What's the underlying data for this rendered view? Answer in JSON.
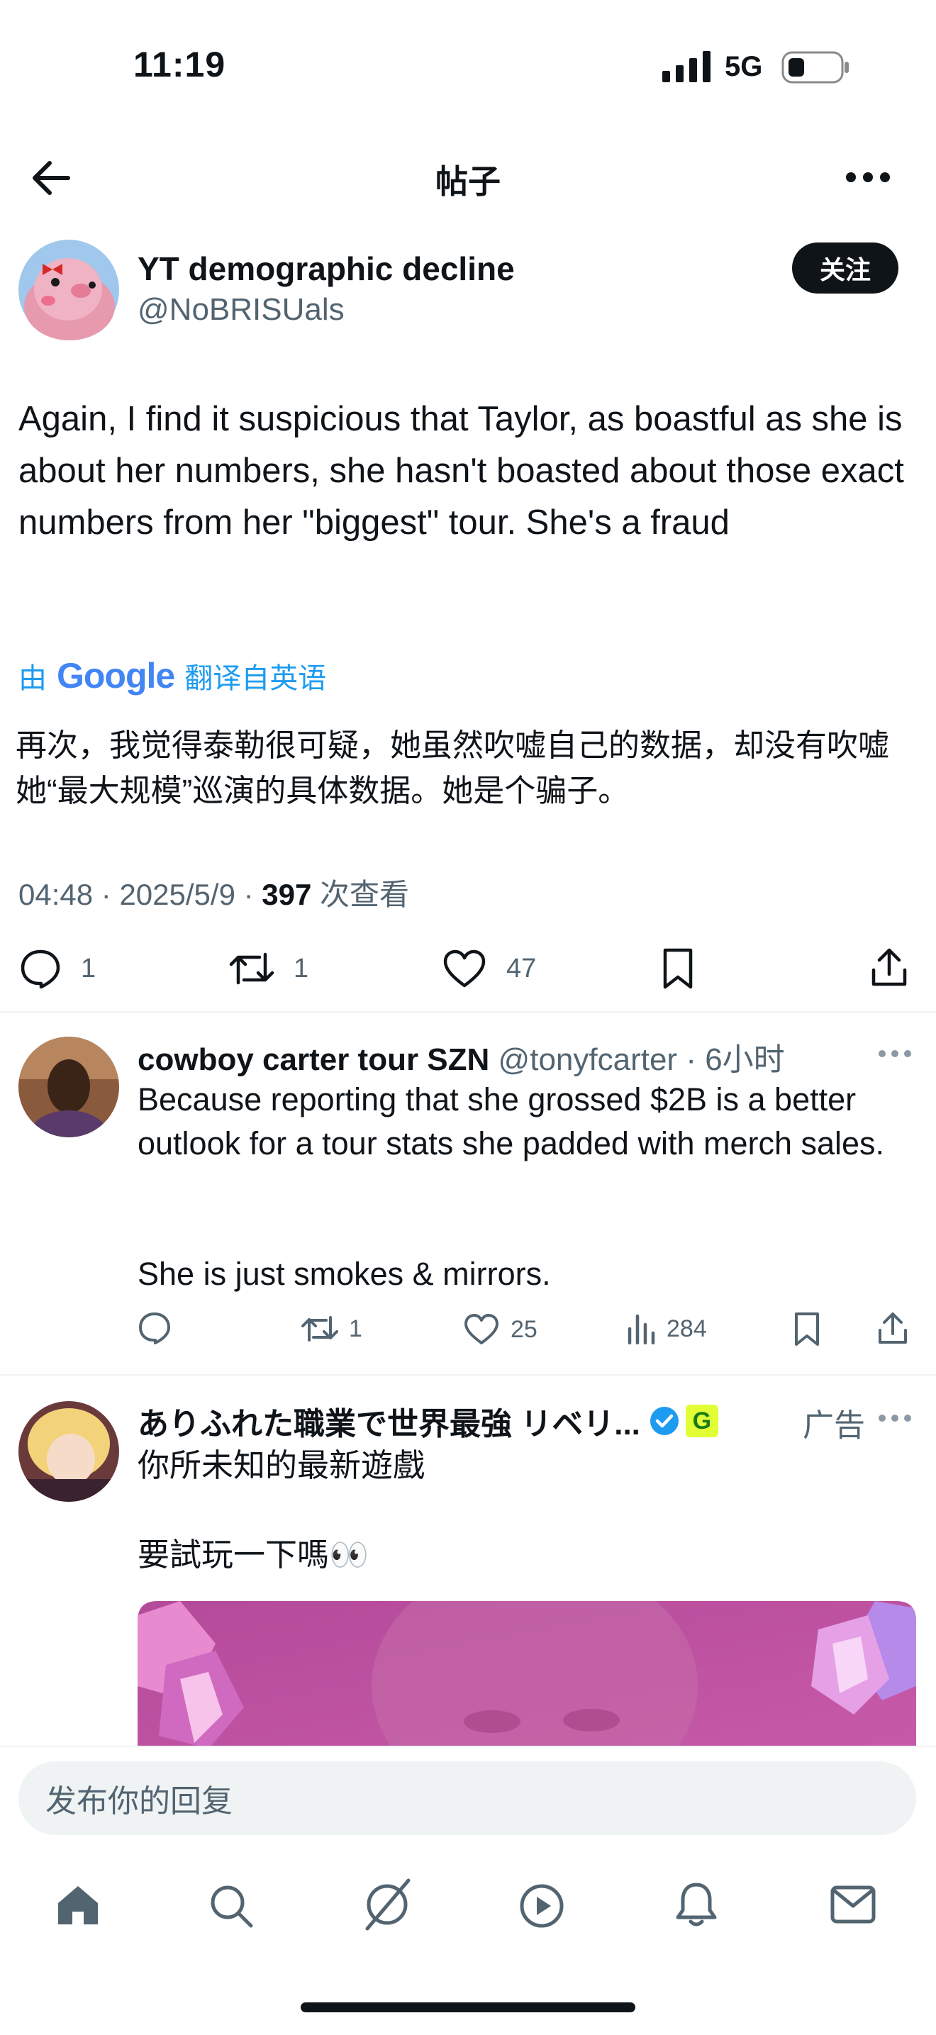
{
  "status_bar": {
    "time": "11:19",
    "network": "5G"
  },
  "nav": {
    "title": "帖子"
  },
  "post": {
    "author_name": "YT demographic decline",
    "handle": "@NoBRISUals",
    "follow_label": "关注",
    "text": "Again, I find it suspicious that Taylor, as boastful as she is about her numbers, she hasn't boasted about those exact numbers from her \"biggest\" tour. She's a fraud",
    "translate": {
      "prefix": "由",
      "brand": "Google",
      "suffix": "翻译自英语"
    },
    "translated_text": "再次，我觉得泰勒很可疑，她虽然吹嘘自己的数据，却没有吹嘘她“最大规模”巡演的具体数据。她是个骗子。",
    "time": "04:48",
    "date": "2025/5/9",
    "views_count": "397",
    "views_label": "次查看",
    "replies": "1",
    "reposts": "1",
    "likes": "47"
  },
  "reply": {
    "author_name": "cowboy carter tour SZN",
    "handle": "@tonyfcarter",
    "time": "6小时",
    "text_line1": "Because reporting that she grossed $2B is a better outlook for a tour stats she padded with merch sales.",
    "text_line2": "She is just smokes & mirrors.",
    "reposts": "1",
    "likes": "25",
    "views": "284"
  },
  "ad": {
    "author_name": "ありふれた職業で世界最強 リベリ...",
    "badge": "G",
    "ad_label": "广告",
    "text_line1": "你所未知的最新遊戲",
    "text_line2": "要試玩一下嗎👀"
  },
  "composer": {
    "placeholder": "发布你的回复"
  },
  "colors": {
    "accent": "#1d9bf0",
    "text": "#0f1419",
    "muted": "#536471"
  }
}
